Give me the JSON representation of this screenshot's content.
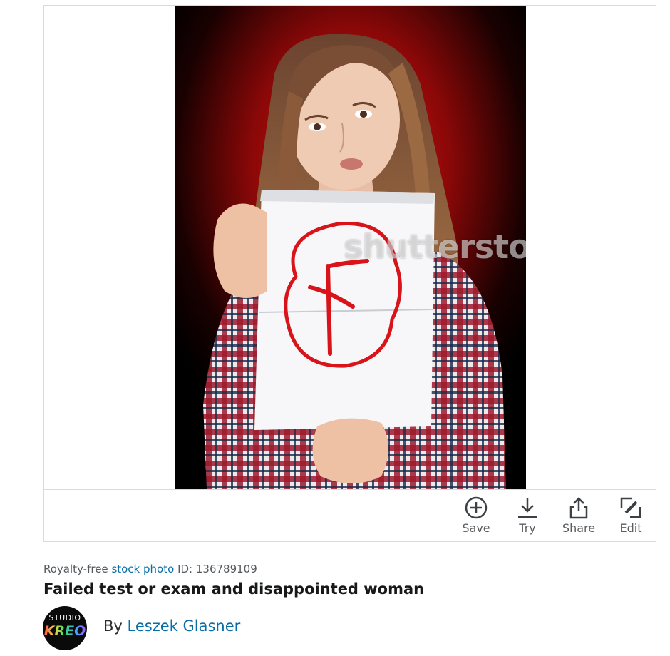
{
  "photo": {
    "watermark": "shutterstock",
    "sign_letter": "F",
    "alt": "Failed test or exam and disappointed woman"
  },
  "actions": [
    {
      "label": "Save",
      "icon": "plus-circle-icon"
    },
    {
      "label": "Try",
      "icon": "download-icon"
    },
    {
      "label": "Share",
      "icon": "share-icon"
    },
    {
      "label": "Edit",
      "icon": "edit-icon"
    }
  ],
  "meta": {
    "prefix": "Royalty-free",
    "link": "stock photo",
    "id_label": "ID:",
    "id": "136789109"
  },
  "title": "Failed test or exam and disappointed woman",
  "contributor": {
    "avatar_top": "STUDIO",
    "avatar_bottom": "KREO",
    "by": "By",
    "name": "Leszek Glasner"
  },
  "colors": {
    "link": "#0a6ea6",
    "grade_red": "#d8141a",
    "background_red": "#b30d0d"
  }
}
